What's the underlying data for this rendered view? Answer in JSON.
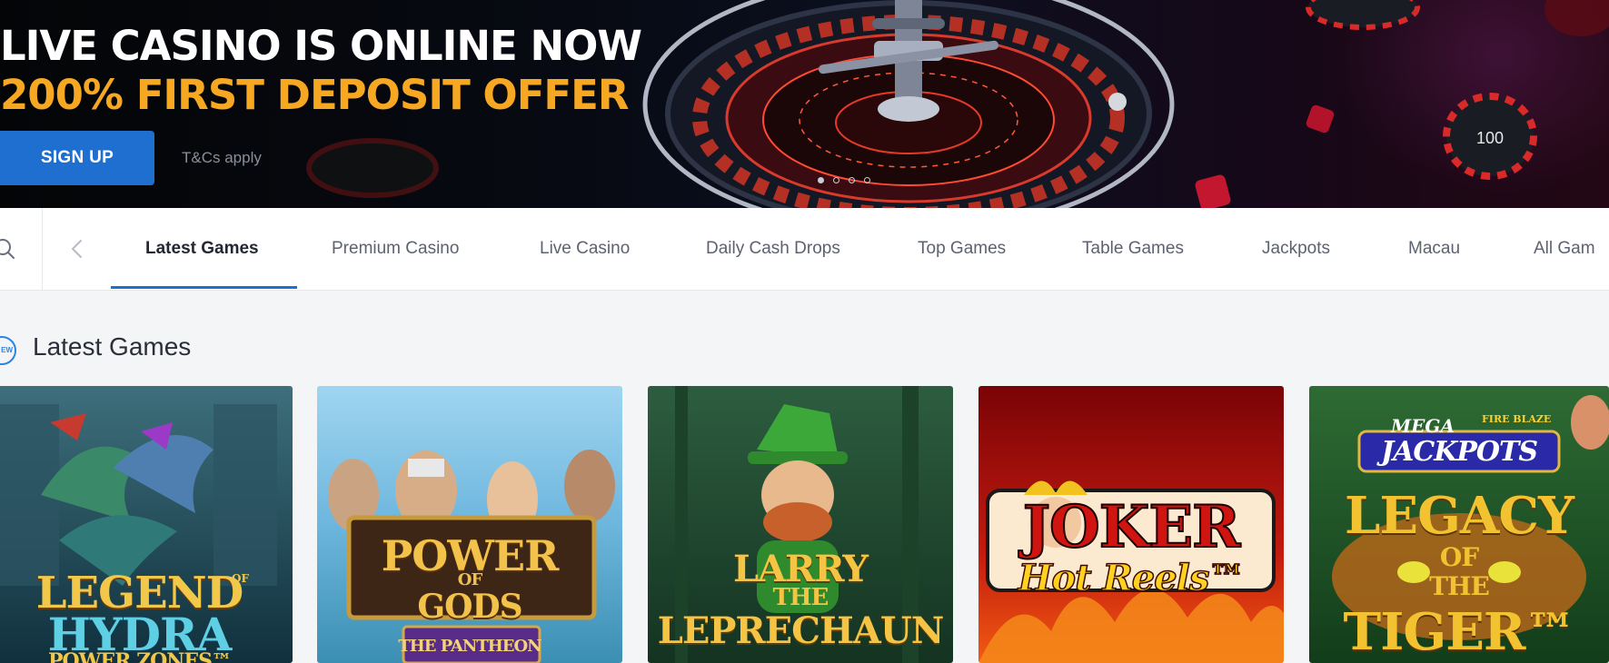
{
  "hero": {
    "line1": "LIVE CASINO IS ONLINE NOW",
    "line2": "200% FIRST DEPOSIT OFFER",
    "signup_label": "SIGN UP",
    "terms": "T&Cs apply",
    "chip_label": "100",
    "slides_total": 4,
    "slide_active": 1,
    "colors": {
      "accent": "#f7a823",
      "button": "#1e6fd0"
    }
  },
  "nav": {
    "tabs": [
      {
        "label": "Latest Games",
        "active": true
      },
      {
        "label": "Premium Casino"
      },
      {
        "label": "Live Casino"
      },
      {
        "label": "Daily Cash Drops"
      },
      {
        "label": "Top Games"
      },
      {
        "label": "Table Games"
      },
      {
        "label": "Jackpots"
      },
      {
        "label": "Macau"
      },
      {
        "label": "All Gam"
      }
    ],
    "icons": {
      "search": "search-icon",
      "prev": "chevron-left-icon"
    }
  },
  "section": {
    "badge": "EW",
    "title": "Latest Games"
  },
  "games": [
    {
      "line1": "LEGEND",
      "small": "OF",
      "line2": "HYDRA",
      "line3": "POWER ZONES™"
    },
    {
      "line1": "POWER",
      "line2": "OF",
      "line3": "GODS",
      "line4": "THE PANTHEON"
    },
    {
      "line1": "LARRY",
      "line2": "THE",
      "line3": "LEPRECHAUN"
    },
    {
      "line1": "JOKER",
      "line2": "Hot Reels™"
    },
    {
      "brand1": "MEGA",
      "brand2": "FIRE BLAZE",
      "line1": "JACKPOTS",
      "line2": "LEGACY",
      "line3": "OF",
      "line4": "THE",
      "line5": "TIGER™"
    }
  ]
}
